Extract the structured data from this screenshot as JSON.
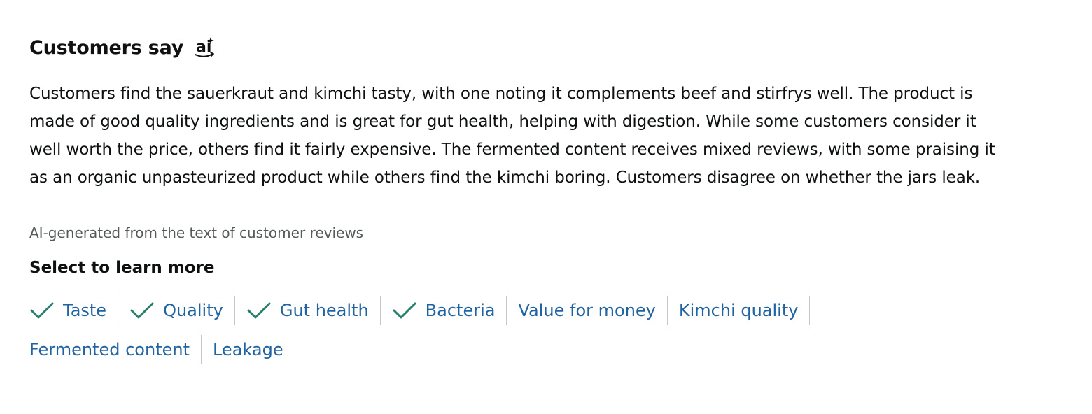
{
  "heading": {
    "title": "Customers say",
    "badge_icon": "ai-sparkle-icon"
  },
  "summary": "Customers find the sauerkraut and kimchi tasty, with one noting it complements beef and stirfrys well. The product is made of good quality ingredients and is great for gut health, helping with digestion. While some customers consider it well worth the price, others find it fairly expensive. The fermented content receives mixed reviews, with some praising it as an organic unpasteurized product while others find the kimchi boring. Customers disagree on whether the jars leak.",
  "disclaimer": "AI-generated from the text of customer reviews",
  "learn_more": {
    "heading": "Select to learn more",
    "rows": [
      [
        {
          "label": "Taste",
          "checked": true
        },
        {
          "label": "Quality",
          "checked": true
        },
        {
          "label": "Gut health",
          "checked": true
        },
        {
          "label": "Bacteria",
          "checked": true
        },
        {
          "label": "Value for money",
          "checked": false
        },
        {
          "label": "Kimchi quality",
          "checked": false
        }
      ],
      [
        {
          "label": "Fermented content",
          "checked": false
        },
        {
          "label": "Leakage",
          "checked": false
        }
      ]
    ]
  },
  "colors": {
    "link": "#2162a1",
    "check": "#257f6a",
    "text": "#0f1111",
    "muted": "#565959",
    "divider": "#c6c6c6"
  }
}
